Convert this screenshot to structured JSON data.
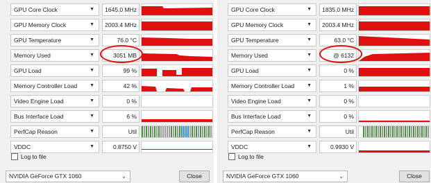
{
  "colors": {
    "graph_red": "#e01010",
    "perfcap_green": "#3c9a2c",
    "perfcap_gray": "#9a9a9a",
    "perfcap_blue": "#2a8ae0",
    "highlight": "#e01010"
  },
  "left": {
    "rows": [
      {
        "label": "GPU Core Clock",
        "value": "1645.0 MHz"
      },
      {
        "label": "GPU Memory Clock",
        "value": "2003.4 MHz"
      },
      {
        "label": "GPU Temperature",
        "value": "76.0 °C"
      },
      {
        "label": "Memory Used",
        "value": "3051 MB"
      },
      {
        "label": "GPU Load",
        "value": "99 %"
      },
      {
        "label": "Memory Controller Load",
        "value": "42 %"
      },
      {
        "label": "Video Engine Load",
        "value": "0 %"
      },
      {
        "label": "Bus Interface Load",
        "value": "6 %"
      },
      {
        "label": "PerfCap Reason",
        "value": "Util"
      },
      {
        "label": "VDDC",
        "value": "0.8750 V"
      }
    ],
    "log_label": "Log to file",
    "gpu_name": "NVIDIA GeForce GTX 1060",
    "close_label": "Close"
  },
  "right": {
    "rows": [
      {
        "label": "GPU Core Clock",
        "value": "1835.0 MHz"
      },
      {
        "label": "GPU Memory Clock",
        "value": "2003.4 MHz"
      },
      {
        "label": "GPU Temperature",
        "value": "63.0 °C"
      },
      {
        "label": "Memory Used",
        "value": "@ 6132"
      },
      {
        "label": "GPU Load",
        "value": "0 %"
      },
      {
        "label": "Memory Controller Load",
        "value": "1 %"
      },
      {
        "label": "Video Engine Load",
        "value": "0 %"
      },
      {
        "label": "Bus Interface Load",
        "value": "0 %"
      },
      {
        "label": "PerfCap Reason",
        "value": "Util"
      },
      {
        "label": "VDDC",
        "value": "0.9930 V"
      }
    ],
    "log_label": "Log to file",
    "gpu_name": "NVIDIA GeForce GTX 1060",
    "close_label": "Close"
  },
  "icons": {
    "dropdown": "▼",
    "select_chevron": "⌄"
  }
}
